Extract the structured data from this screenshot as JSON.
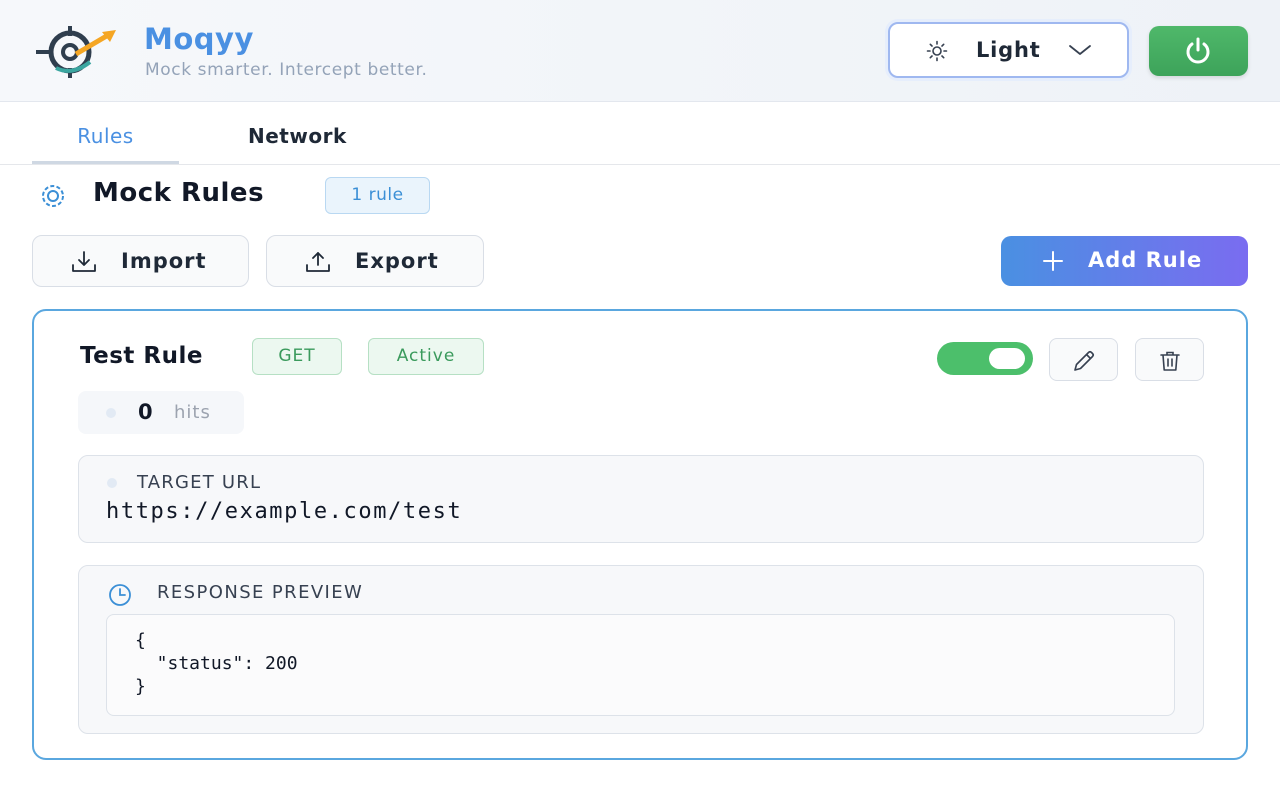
{
  "header": {
    "brand_title": "Moqyy",
    "brand_subtitle": "Mock smarter. Intercept better.",
    "theme_select": {
      "value": "Light",
      "icon": "sun-icon"
    },
    "power_button": {
      "icon": "power-icon",
      "color": "#4fb86a"
    }
  },
  "tabs": [
    {
      "label": "Rules",
      "active": true
    },
    {
      "label": "Network",
      "active": false
    }
  ],
  "section": {
    "title": "Mock Rules",
    "count_badge": "1 rule"
  },
  "toolbar": {
    "import_label": "Import",
    "export_label": "Export",
    "add_label": "Add Rule"
  },
  "rule": {
    "name": "Test Rule",
    "method": "GET",
    "status": "Active",
    "enabled": true,
    "hits_count": "0",
    "hits_label": "hits",
    "target_url_label": "TARGET URL",
    "target_url": "https://example.com/test",
    "response_preview_label": "RESPONSE PREVIEW",
    "response_preview": "{\n  \"status\": 200\n}"
  },
  "colors": {
    "brand": "#4a90e2",
    "accent_gradient_start": "#4a90e2",
    "accent_gradient_end": "#7a6cf0",
    "success": "#4cbf6b",
    "card_border": "#5aa7df"
  }
}
